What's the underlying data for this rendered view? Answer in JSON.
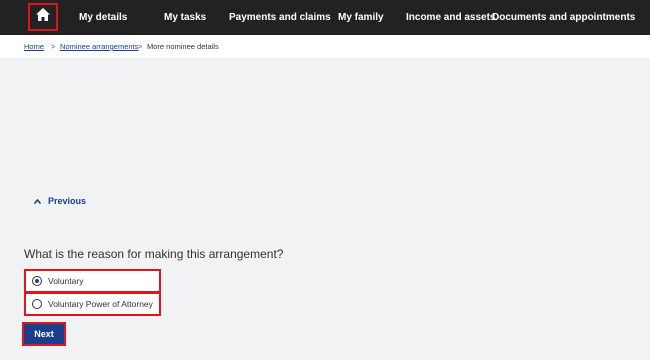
{
  "nav": {
    "home_icon": "home-icon",
    "items": [
      {
        "label": "My details"
      },
      {
        "label": "My tasks"
      },
      {
        "label": "Payments and claims"
      },
      {
        "label": "My family"
      },
      {
        "label": "Income and assets"
      },
      {
        "label": "Documents and appointments"
      }
    ]
  },
  "breadcrumb": {
    "items": [
      "Home",
      "Nominee arrangements",
      "More nominee details"
    ],
    "separator": ">"
  },
  "previous": {
    "label": "Previous",
    "icon": "chevron-up-icon"
  },
  "question": {
    "text": "What is the reason for making this arrangement?"
  },
  "options": [
    {
      "label": "Voluntary",
      "selected": true
    },
    {
      "label": "Voluntary Power of Attorney",
      "selected": false
    }
  ],
  "next_button": {
    "label": "Next"
  },
  "colors": {
    "nav_bg": "#222222",
    "accent": "#1b3f8f",
    "highlight": "#e0141b",
    "page_bg": "#f1f2f4"
  }
}
